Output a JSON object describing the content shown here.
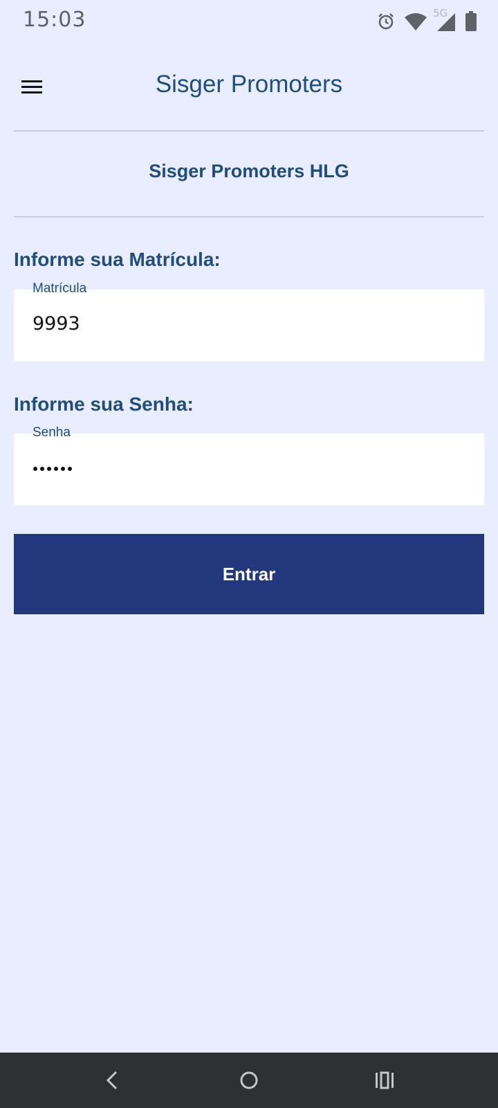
{
  "status_bar": {
    "time": "15:03",
    "network_label": "5G",
    "icons": [
      "alarm-icon",
      "wifi-icon",
      "cell-signal-icon",
      "battery-icon"
    ]
  },
  "app_bar": {
    "title": "Sisger Promoters",
    "menu_icon": "hamburger-menu-icon"
  },
  "subtitle": "Sisger Promoters HLG",
  "login_form": {
    "matricula": {
      "heading": "Informe sua Matrícula:",
      "label": "Matrícula",
      "value": "9993"
    },
    "senha": {
      "heading": "Informe sua Senha:",
      "label": "Senha",
      "masked_length": 6
    },
    "submit_label": "Entrar"
  },
  "nav_bar": {
    "buttons": [
      "back-icon",
      "home-icon",
      "recents-icon"
    ]
  },
  "colors": {
    "background": "#e8eeff",
    "primary_text": "#214d7e",
    "button": "#23387c",
    "nav_bar": "#2f3033"
  }
}
